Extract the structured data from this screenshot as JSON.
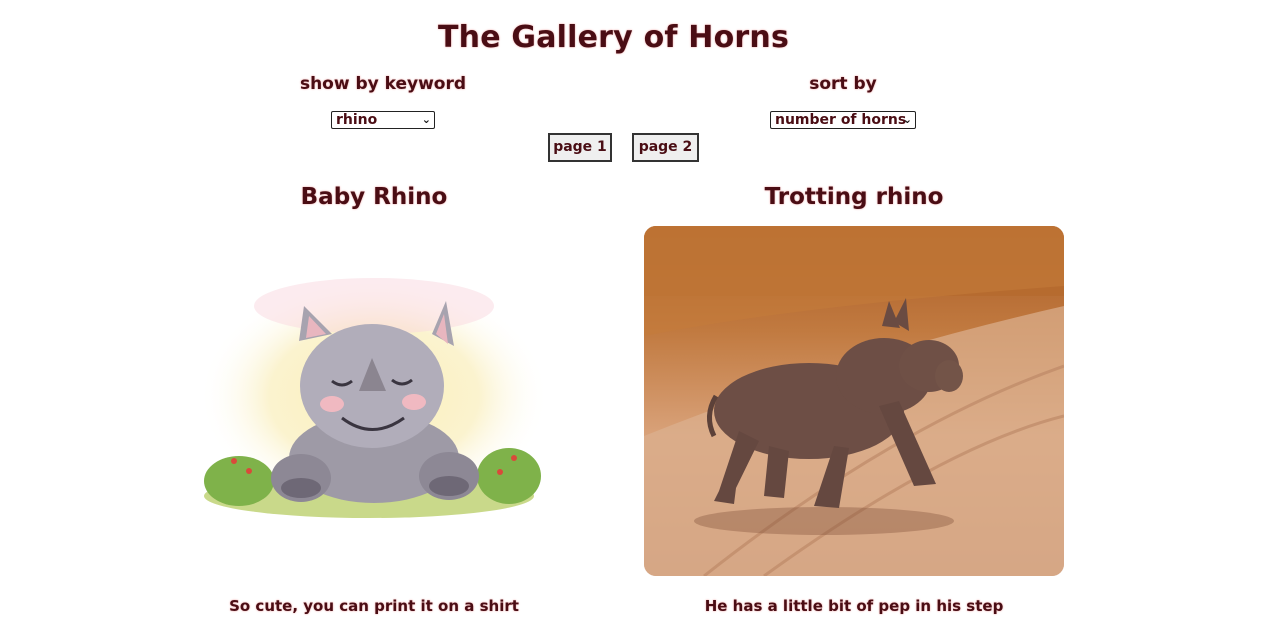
{
  "header": {
    "title": "The Gallery of Horns"
  },
  "filters": {
    "keyword_label": "show by keyword",
    "keyword_value": "rhino",
    "sort_label": "sort by",
    "sort_value": "number of horns"
  },
  "pagination": {
    "page1_label": "page 1",
    "page2_label": "page 2"
  },
  "gallery": {
    "items": [
      {
        "title": "Baby Rhino",
        "description": "So cute, you can print it on a shirt"
      },
      {
        "title": "Trotting rhino",
        "description": "He has a little bit of pep in his step"
      }
    ]
  },
  "icons": {
    "dropdown": "chevron-down-icon"
  }
}
